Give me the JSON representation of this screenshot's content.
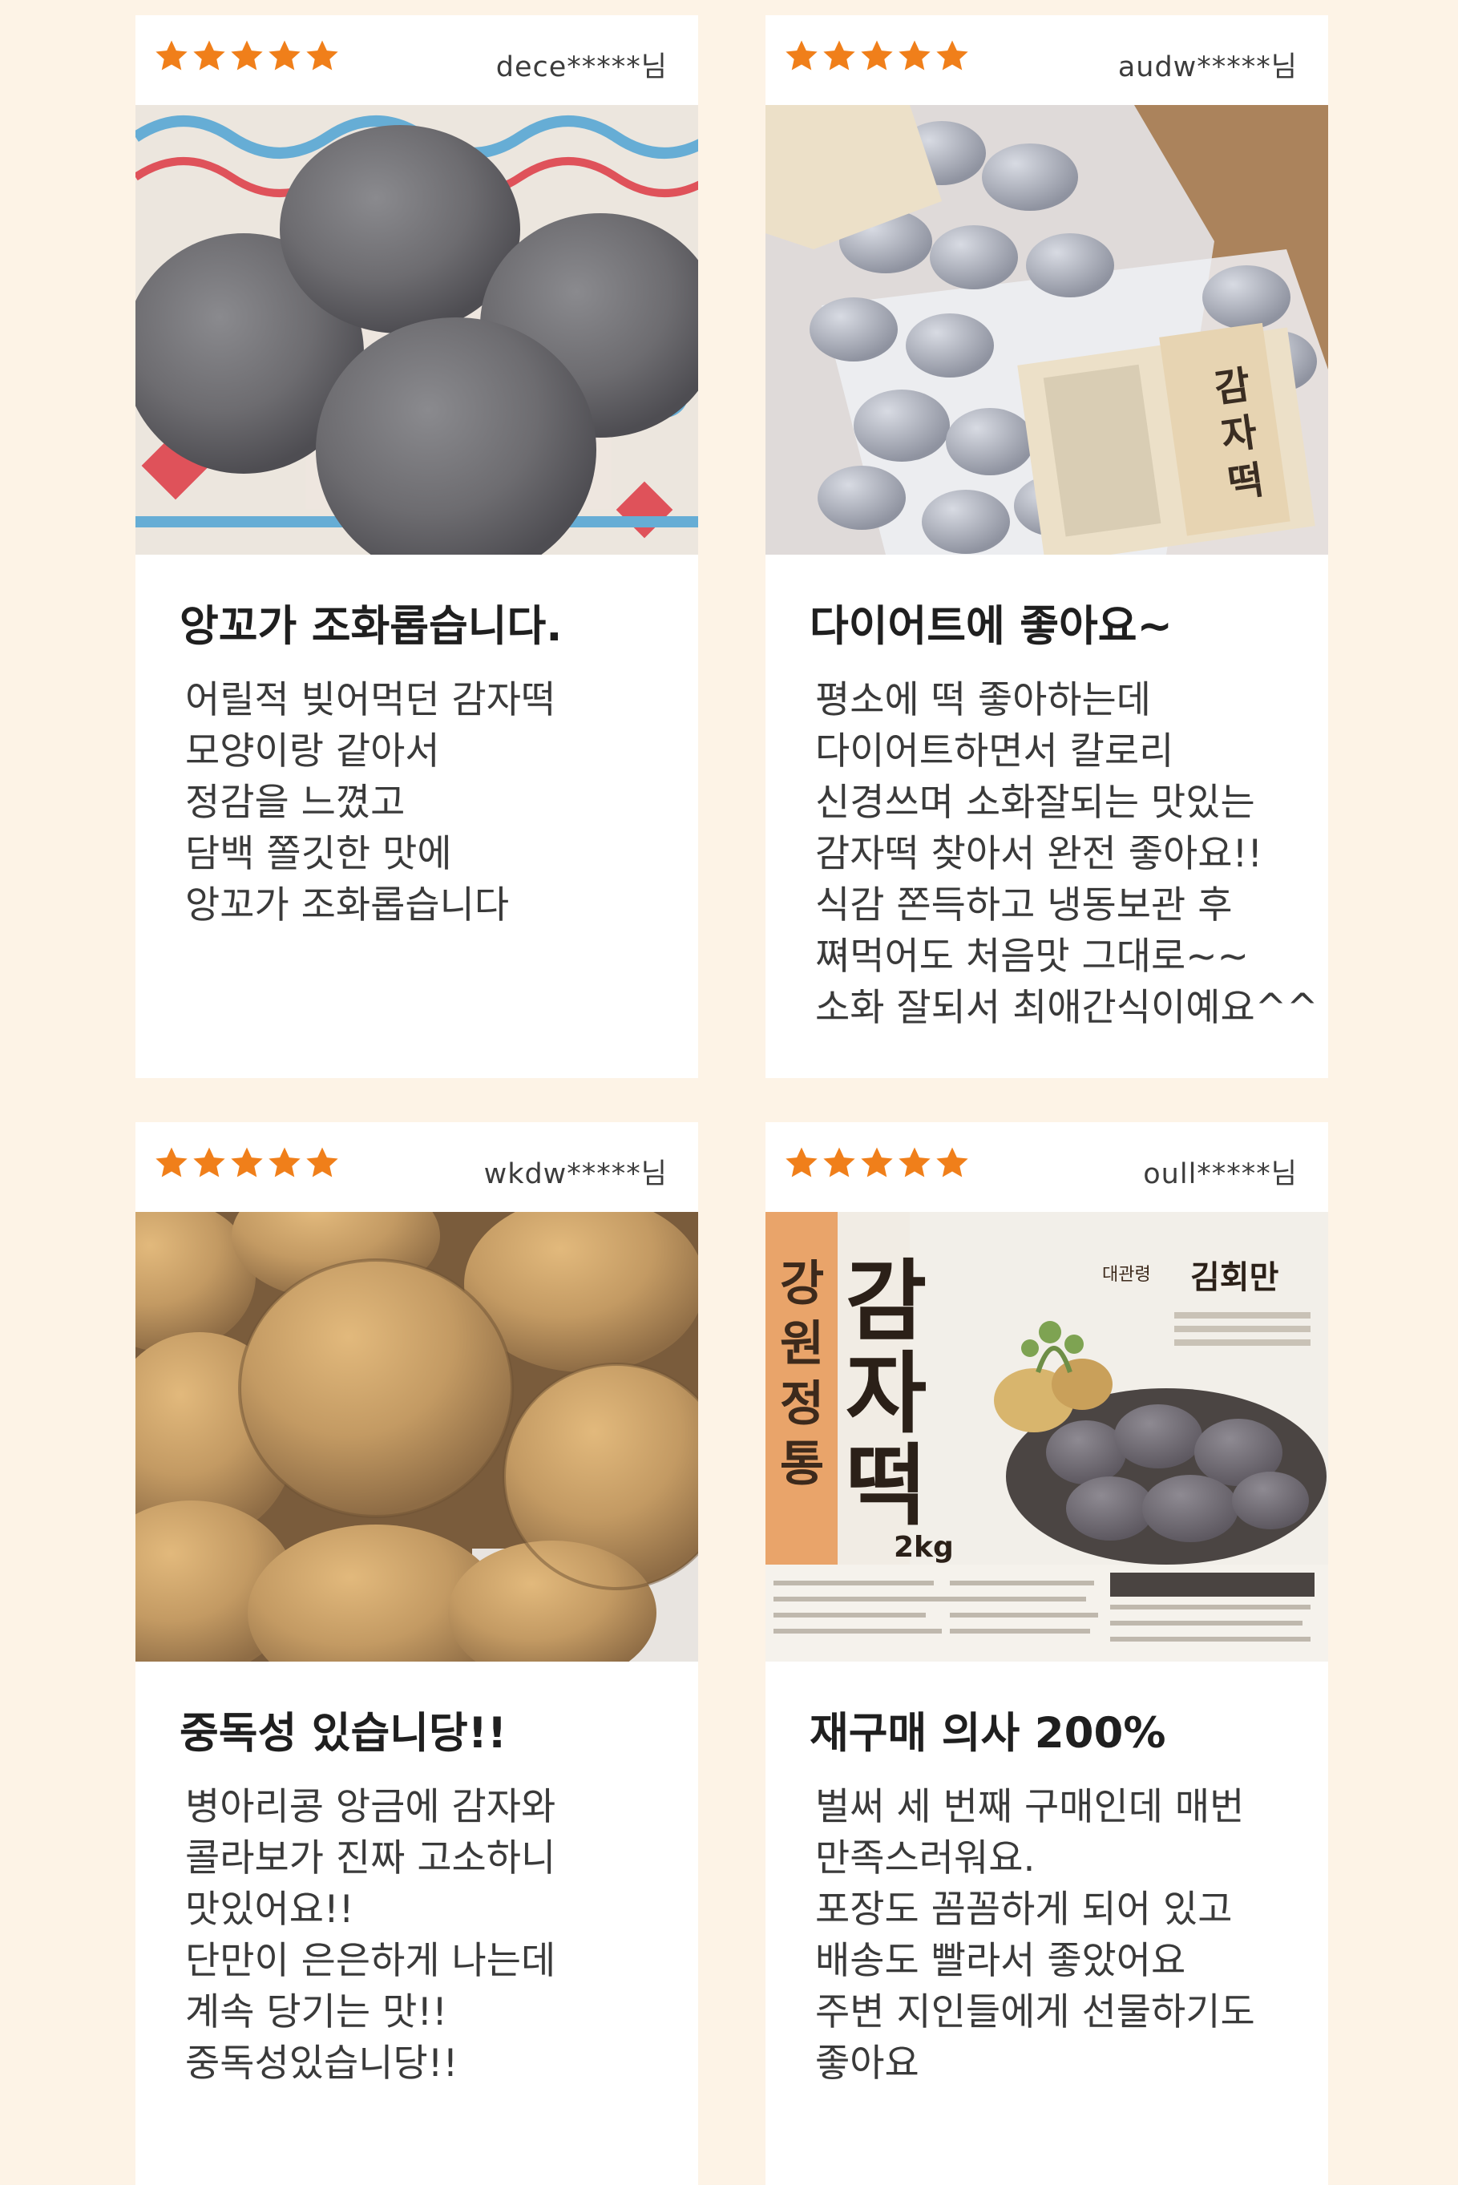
{
  "reviews": [
    {
      "rating": 5,
      "user": "dece*****님",
      "photo": "gray-potato-rice-cakes-on-plate",
      "title": "앙꼬가 조화롭습니다.",
      "lines": [
        "어릴적 빚어먹던 감자떡",
        "모양이랑 같아서",
        "정감을 느꼈고",
        "담백 쫄깃한 맛에",
        "앙꼬가 조화롭습니다"
      ]
    },
    {
      "rating": 5,
      "user": "audw*****님",
      "photo": "frozen-potato-rice-cake-bags",
      "title": "다이어트에 좋아요~",
      "lines": [
        "평소에 떡 좋아하는데",
        "다이어트하면서 칼로리",
        "신경쓰며 소화잘되는 맛있는",
        "감자떡 찾아서 완전 좋아요!!",
        "식감 쫀득하고 냉동보관 후",
        "쪄먹어도 처음맛 그대로~~",
        "소화 잘되서 최애간식이예요^^"
      ]
    },
    {
      "rating": 5,
      "user": "wkdw*****님",
      "photo": "golden-steamed-potato-rice-cakes",
      "title": "중독성 있습니당!!",
      "lines": [
        "병아리콩 앙금에 감자와",
        "콜라보가 진짜 고소하니",
        "맛있어요!!",
        "단만이 은은하게 나는데",
        "계속 당기는 맛!!",
        "중독성있습니당!!"
      ]
    },
    {
      "rating": 5,
      "user": "oull*****님",
      "photo": "gamja-tteok-package",
      "package": {
        "side": [
          "강",
          "원",
          "정",
          "통"
        ],
        "main": [
          "감",
          "자",
          "떡"
        ],
        "weight": "2kg",
        "brand_small": "대관령",
        "brand": "김회만"
      },
      "title": "재구매 의사 200%",
      "lines": [
        "벌써 세 번째 구매인데 매번",
        "만족스러워요.",
        "포장도 꼼꼼하게 되어 있고",
        "배송도 빨라서 좋았어요",
        "주변 지인들에게 선물하기도",
        "좋아요"
      ]
    }
  ],
  "colors": {
    "star": "#f07f1a",
    "background": "#fdf3e6",
    "card": "#ffffff"
  }
}
